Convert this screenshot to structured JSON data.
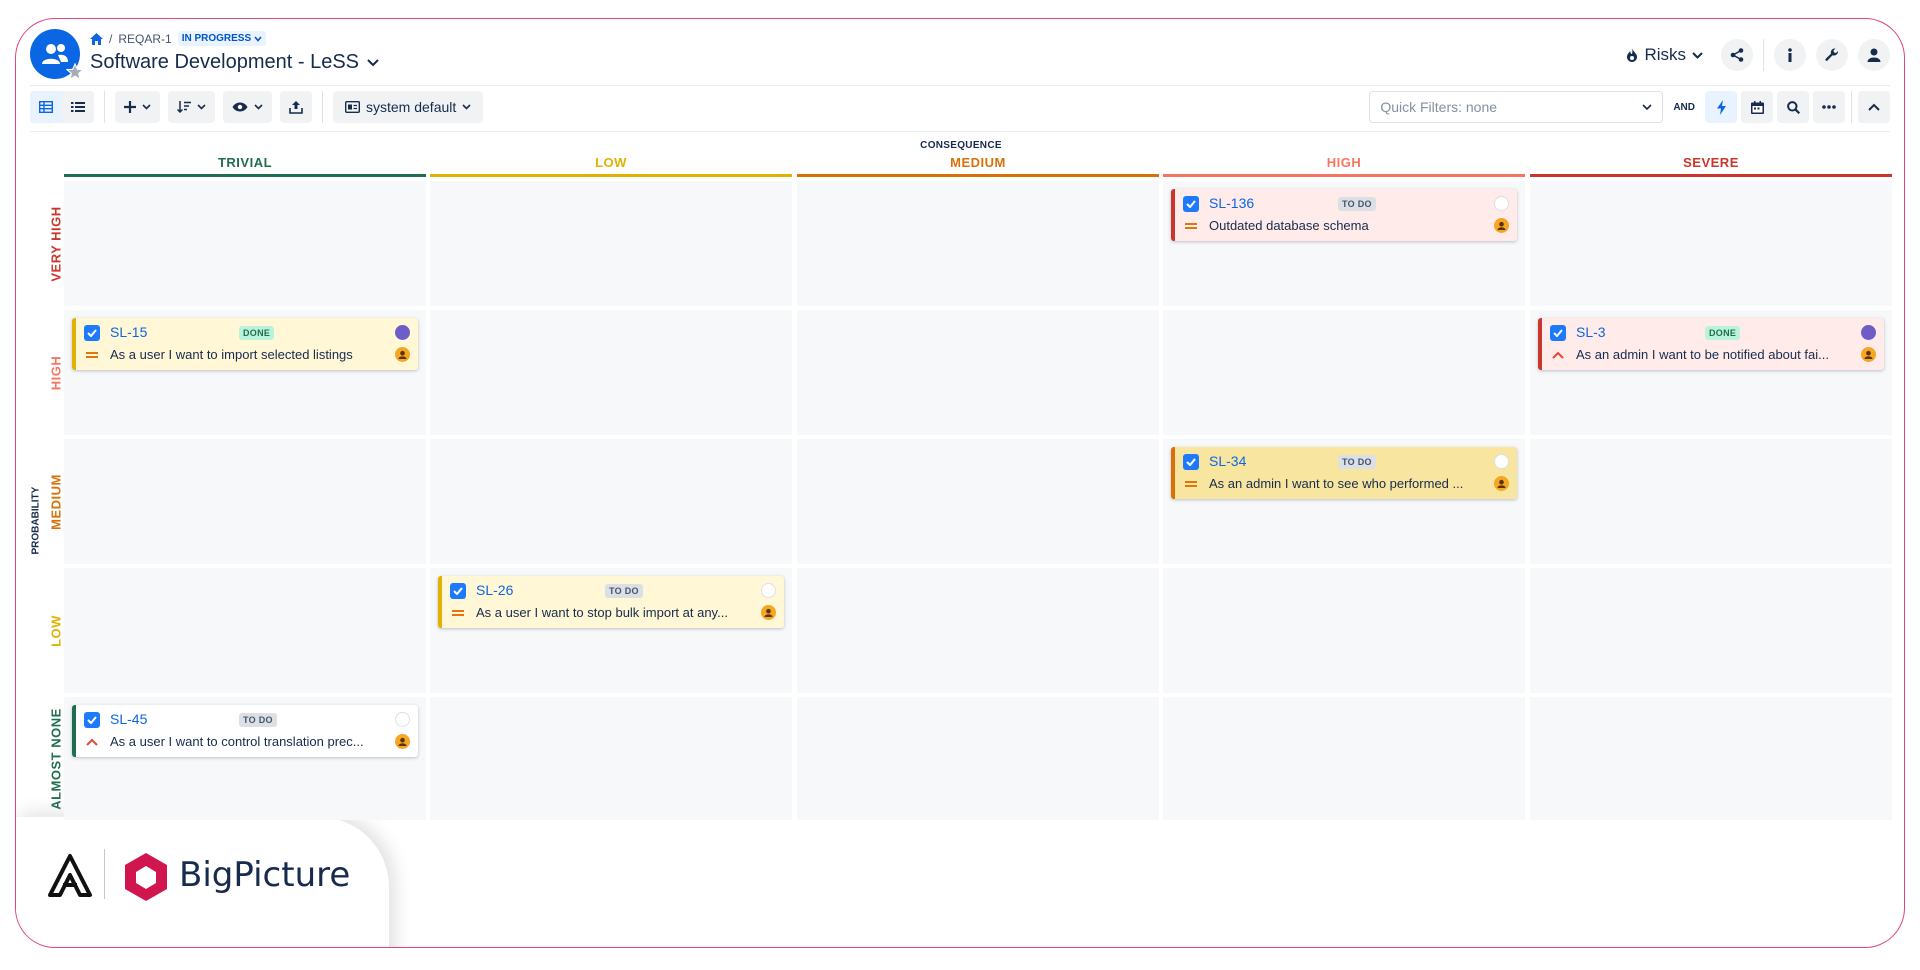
{
  "header": {
    "breadcrumb_key": "REQAR-1",
    "breadcrumb_status": "IN PROGRESS",
    "project_title": "Software Development - LeSS",
    "risks_label": "Risks"
  },
  "toolbar": {
    "view_preset": "system default",
    "quick_filters_placeholder": "Quick Filters: none",
    "and_label": "AND"
  },
  "matrix": {
    "consequence_title": "CONSEQUENCE",
    "probability_title": "PROBABILITY",
    "columns": [
      {
        "label": "TRIVIAL",
        "color": "#216e4e"
      },
      {
        "label": "LOW",
        "color": "#e2b203"
      },
      {
        "label": "MEDIUM",
        "color": "#d97008"
      },
      {
        "label": "HIGH",
        "color": "#f87462"
      },
      {
        "label": "SEVERE",
        "color": "#c9372c"
      }
    ],
    "rows": [
      {
        "label": "VERY HIGH",
        "color": "#c9372c"
      },
      {
        "label": "HIGH",
        "color": "#f87462"
      },
      {
        "label": "MEDIUM",
        "color": "#d97008"
      },
      {
        "label": "LOW",
        "color": "#e2b203"
      },
      {
        "label": "ALMOST NONE",
        "color": "#216e4e"
      }
    ]
  },
  "cards": [
    {
      "key": "SL-136",
      "status": "TO DO",
      "summary": "Outdated database schema",
      "row": 0,
      "col": 3,
      "bg": "#ffecea",
      "border": "#c9372c",
      "priority": "medium"
    },
    {
      "key": "SL-15",
      "status": "DONE",
      "summary": "As a user I want to import selected listings",
      "row": 1,
      "col": 0,
      "bg": "#fff7d6",
      "border": "#e2b203",
      "priority": "medium"
    },
    {
      "key": "SL-3",
      "status": "DONE",
      "summary": "As an admin I want to be notified about fai...",
      "row": 1,
      "col": 4,
      "bg": "#ffecea",
      "border": "#c9372c",
      "priority": "high"
    },
    {
      "key": "SL-34",
      "status": "TO DO",
      "summary": "As an admin I want to see who performed ...",
      "row": 2,
      "col": 3,
      "bg": "#f8e6a0",
      "border": "#d97008",
      "priority": "medium"
    },
    {
      "key": "SL-26",
      "status": "TO DO",
      "summary": "As a user I want to stop bulk import at any...",
      "row": 3,
      "col": 1,
      "bg": "#fff7d6",
      "border": "#e2b203",
      "priority": "medium"
    },
    {
      "key": "SL-45",
      "status": "TO DO",
      "summary": "As a user I want to control translation prec...",
      "row": 4,
      "col": 0,
      "bg": "#ffffff",
      "border": "#216e4e",
      "priority": "high"
    }
  ],
  "branding": {
    "product_name": "BigPicture"
  }
}
